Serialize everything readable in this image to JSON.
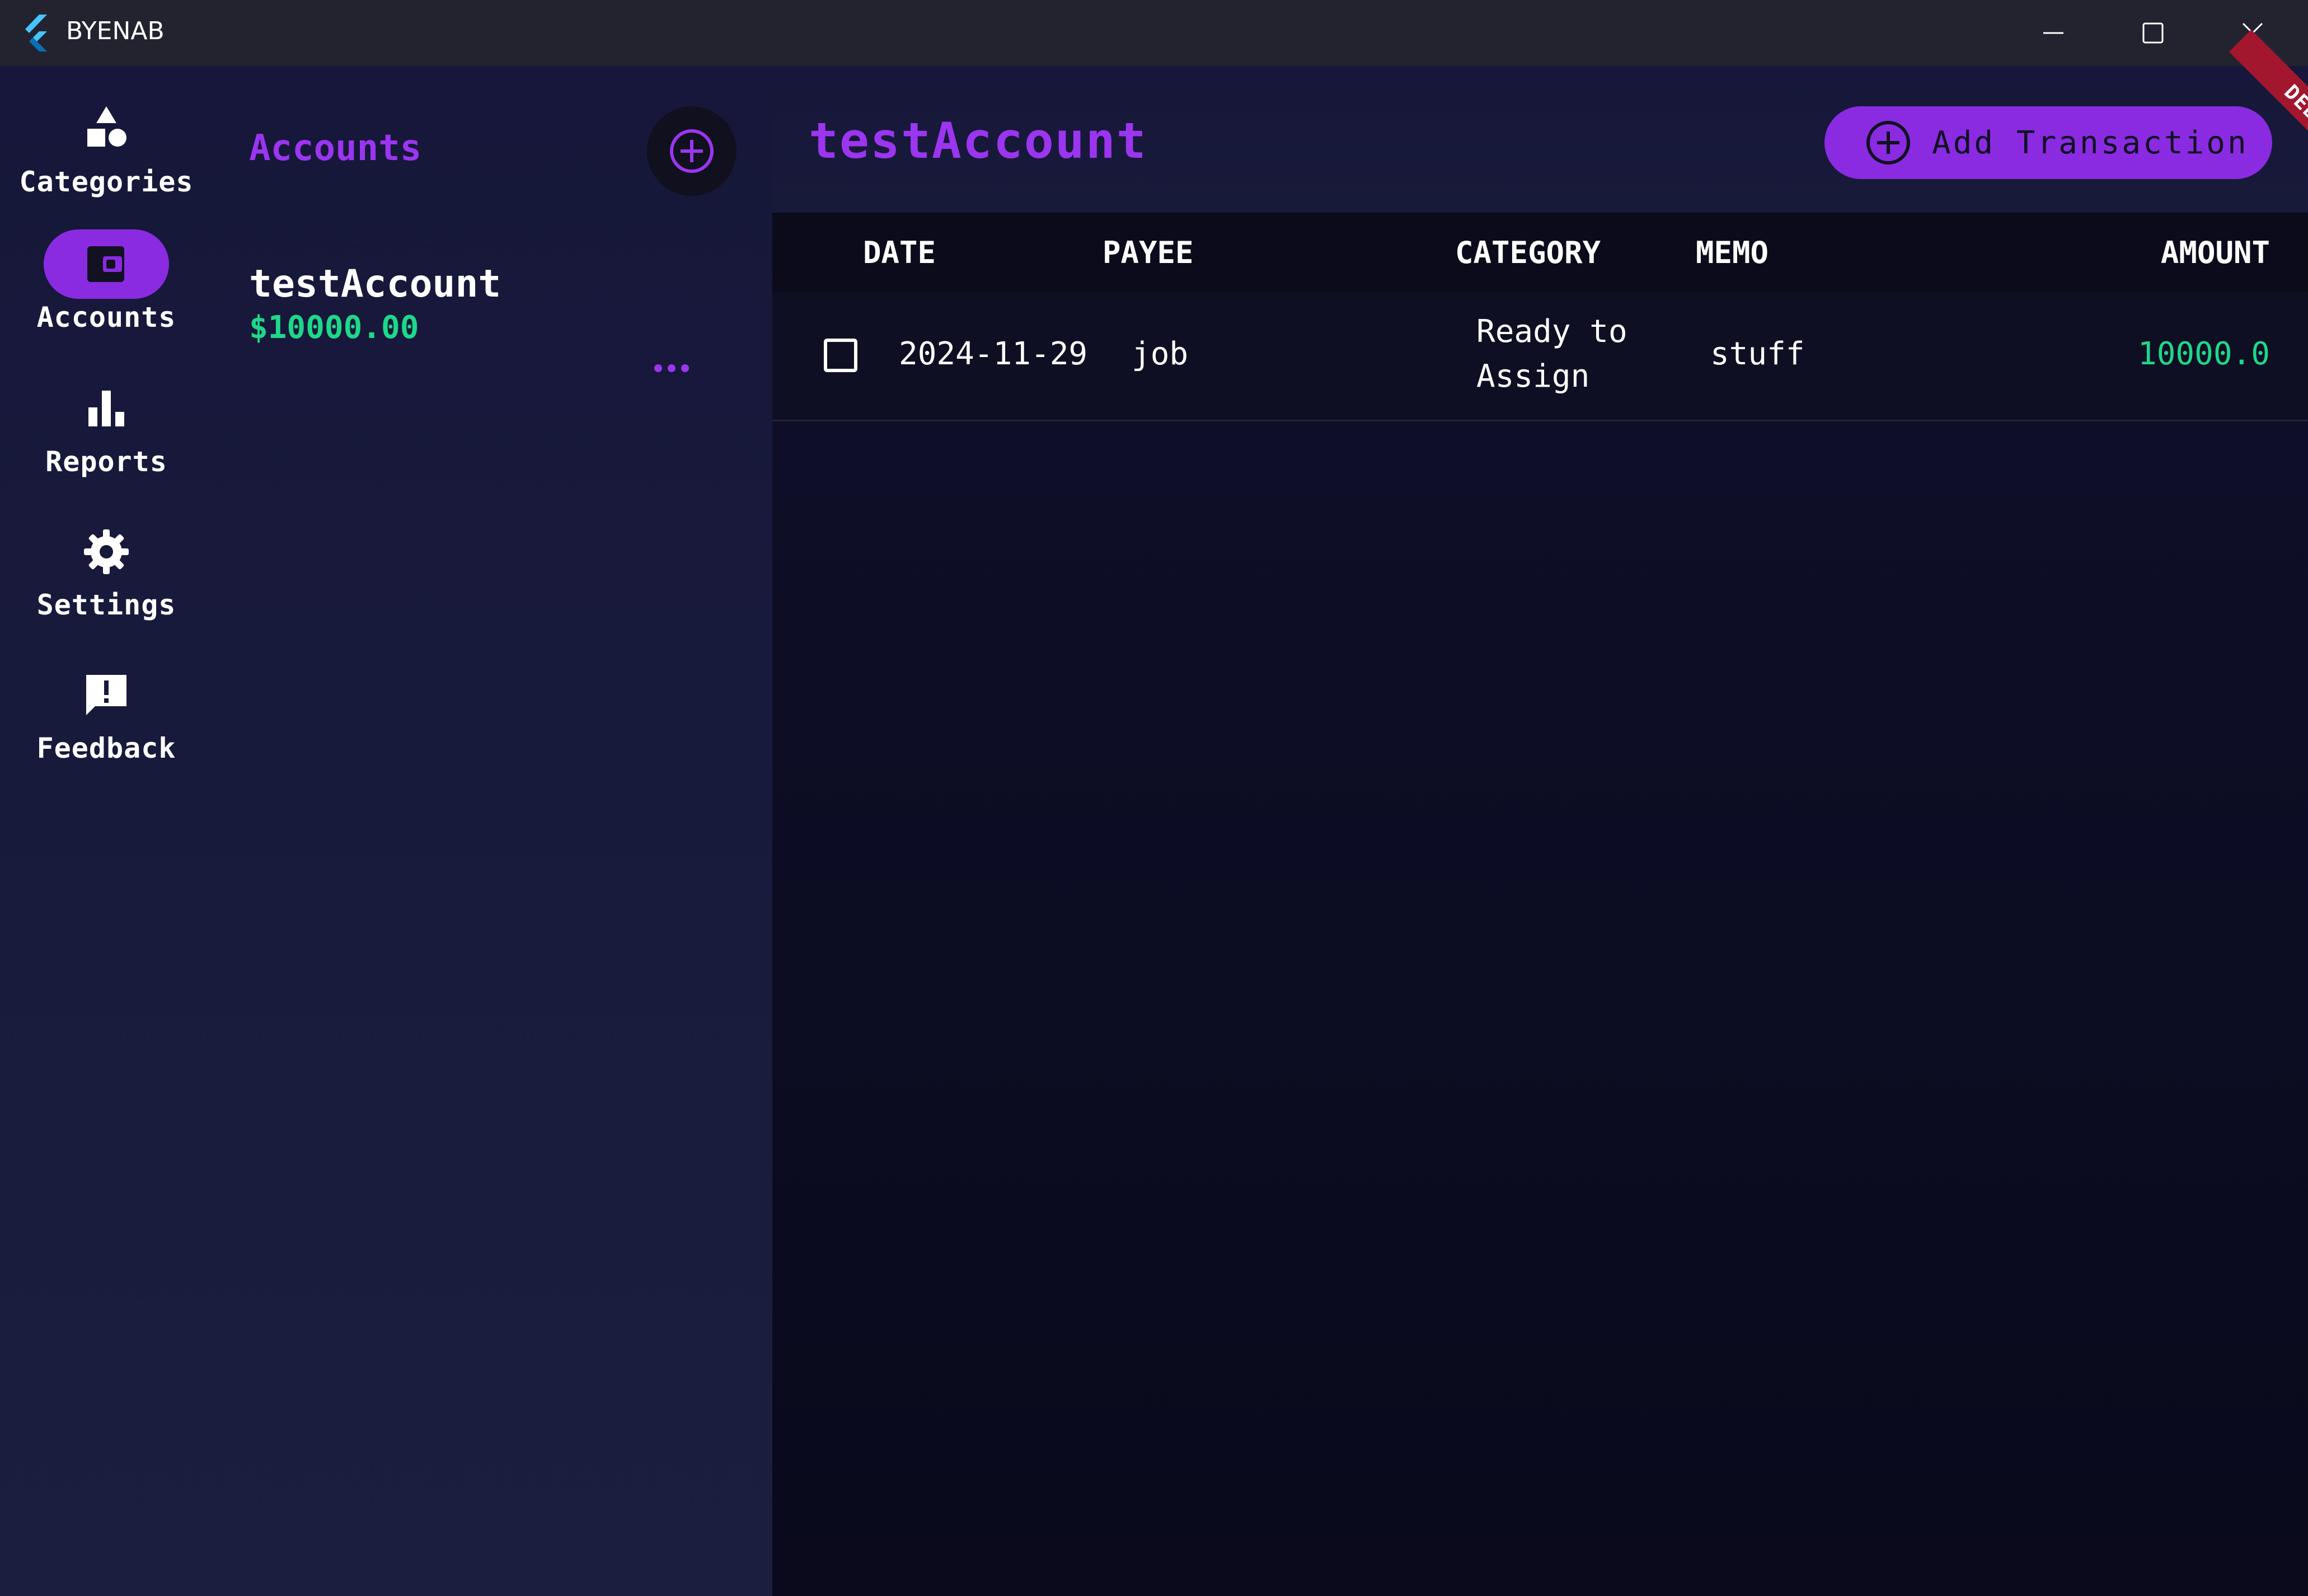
{
  "window": {
    "title": "BYENAB"
  },
  "nav": {
    "items": [
      {
        "label": "Categories",
        "icon": "categories-icon",
        "active": false
      },
      {
        "label": "Accounts",
        "icon": "wallet-icon",
        "active": true
      },
      {
        "label": "Reports",
        "icon": "bar-chart-icon",
        "active": false
      },
      {
        "label": "Settings",
        "icon": "gear-icon",
        "active": false
      },
      {
        "label": "Feedback",
        "icon": "feedback-icon",
        "active": false
      }
    ]
  },
  "accounts_panel": {
    "title": "Accounts",
    "accounts": [
      {
        "name": "testAccount",
        "balance": "$10000.00"
      }
    ]
  },
  "main": {
    "title": "testAccount",
    "add_transaction_label": "Add Transaction",
    "debug_label": "DEBUG",
    "table": {
      "columns": [
        "DATE",
        "PAYEE",
        "CATEGORY",
        "MEMO",
        "AMOUNT"
      ],
      "rows": [
        {
          "checked": false,
          "date": "2024-11-29",
          "payee": "job",
          "category_line1": "Ready to",
          "category_line2": "Assign",
          "memo": "stuff",
          "amount": "10000.0"
        }
      ]
    }
  },
  "colors": {
    "accent": "#8a2be2",
    "accent_text": "#9b35f0",
    "positive": "#1ed889",
    "titlebar": "#232330",
    "debug": "#a3172e"
  }
}
